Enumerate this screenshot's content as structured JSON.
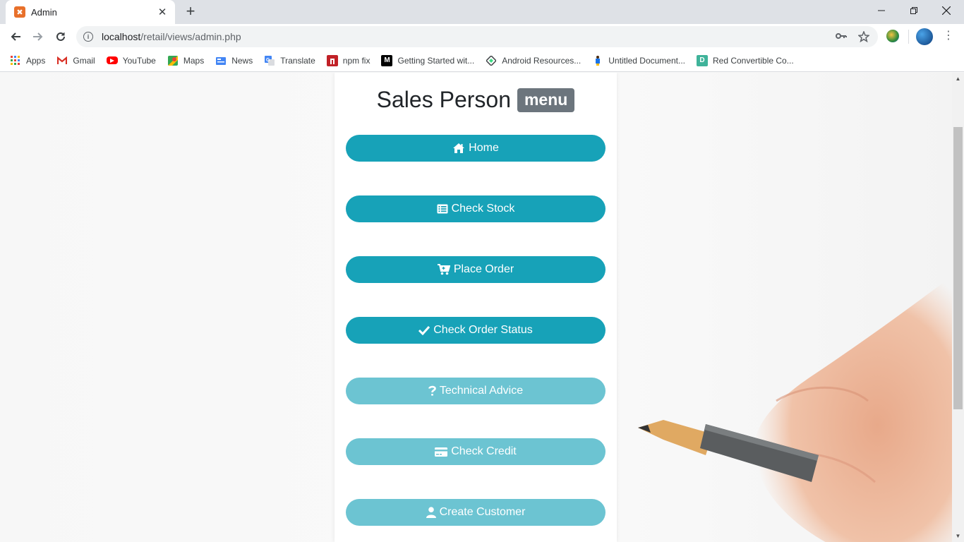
{
  "browser": {
    "tab": {
      "title": "Admin",
      "favicon": "xampp-icon"
    },
    "new_tab_label": "+",
    "url_host": "localhost",
    "url_path": "/retail/views/admin.php",
    "bookmarks": [
      {
        "label": "Apps",
        "icon": "apps-grid-icon"
      },
      {
        "label": "Gmail",
        "icon": "gmail-icon"
      },
      {
        "label": "YouTube",
        "icon": "youtube-icon"
      },
      {
        "label": "Maps",
        "icon": "maps-icon"
      },
      {
        "label": "News",
        "icon": "news-icon"
      },
      {
        "label": "Translate",
        "icon": "translate-icon"
      },
      {
        "label": "npm fix",
        "icon": "npm-icon"
      },
      {
        "label": "Getting Started wit...",
        "icon": "medium-icon"
      },
      {
        "label": "Android Resources...",
        "icon": "android-resources-icon"
      },
      {
        "label": "Untitled Document...",
        "icon": "document-icon"
      },
      {
        "label": "Red Convertible Co...",
        "icon": "docs-icon"
      }
    ]
  },
  "page": {
    "heading": "Sales Person",
    "badge": "menu",
    "menu": [
      {
        "label": "Home",
        "icon": "home-icon",
        "state": "active"
      },
      {
        "label": "Check Stock",
        "icon": "list-icon",
        "state": "active"
      },
      {
        "label": "Place Order",
        "icon": "cart-icon",
        "state": "active"
      },
      {
        "label": "Check Order Status",
        "icon": "check-icon",
        "state": "active"
      },
      {
        "label": "Technical Advice",
        "icon": "question-icon",
        "state": "disabled"
      },
      {
        "label": "Check Credit",
        "icon": "credit-card-icon",
        "state": "disabled"
      },
      {
        "label": "Create Customer",
        "icon": "user-icon",
        "state": "disabled"
      }
    ]
  },
  "colors": {
    "button_active": "#17a2b8",
    "button_disabled": "#6cc4d2",
    "badge": "#6c757d"
  }
}
